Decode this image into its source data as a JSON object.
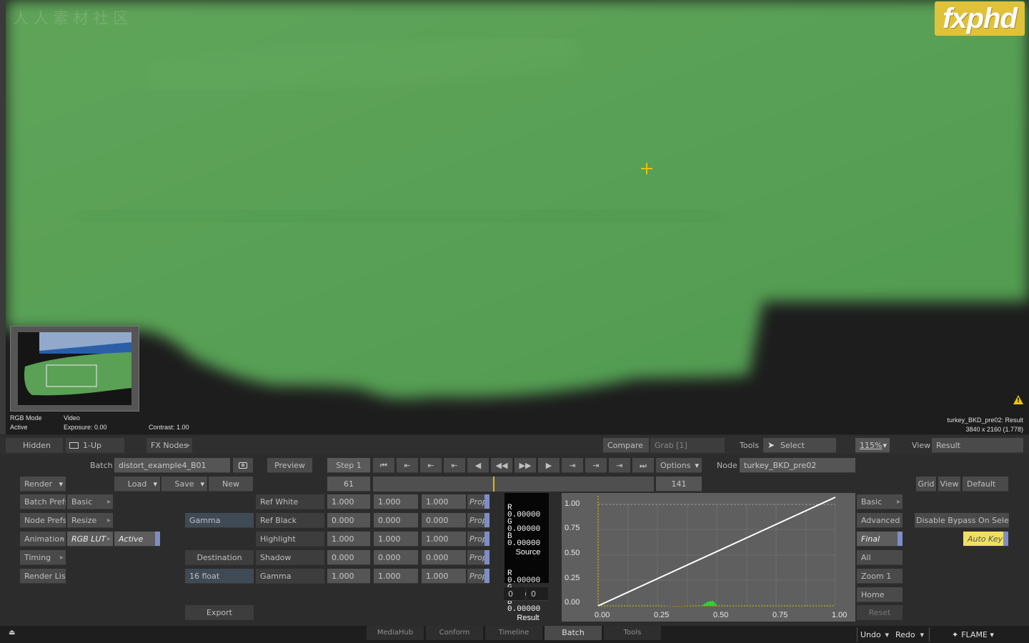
{
  "viewer": {
    "watermark": "人人素材社区",
    "brand_logo": "fxphd",
    "rgb_mode_label": "RGB Mode",
    "rgb_mode_value": "Active",
    "video_label": "Video",
    "exposure": "Exposure: 0.00",
    "contrast": "Contrast: 1.00",
    "clip_name": "turkey_BKD_pre02: Result",
    "resolution": "3840 x 2160 (1.778)",
    "warning_icon": "warning-icon",
    "crosshair_icon": "crosshair-icon"
  },
  "strip": {
    "hidden": "Hidden",
    "layout": "1-Up",
    "fx_nodes": "FX Nodes",
    "compare": "Compare",
    "grab": "Grab [1]",
    "tools_label": "Tools",
    "select": "Select",
    "zoom": "115%",
    "view_label": "View",
    "view_value": "Result"
  },
  "batch": {
    "label": "Batch",
    "name": "distort_example4_B01",
    "preview": "Preview",
    "step": "Step 1",
    "options": "Options",
    "node_label": "Node",
    "node_name": "turkey_BKD_pre02",
    "render": "Render",
    "load": "Load",
    "save": "Save",
    "new": "New",
    "frame_start": "61",
    "frame_end": "141",
    "grid": "Grid",
    "view": "View",
    "default": "Default"
  },
  "left_menu": {
    "batch_prefs": "Batch Prefs",
    "basic": "Basic",
    "node_prefs": "Node Prefs",
    "resize": "Resize",
    "animation": "Animation",
    "rgb_lut": "RGB LUT",
    "active": "Active",
    "timing": "Timing",
    "render_list": "Render List"
  },
  "lut": {
    "gamma_button": "Gamma",
    "destination": "Destination",
    "depth": "16 float",
    "export": "Export",
    "rows": [
      {
        "label": "Ref White",
        "r": "1.000",
        "g": "1.000",
        "b": "1.000",
        "prop": "Prop"
      },
      {
        "label": "Ref Black",
        "r": "0.000",
        "g": "0.000",
        "b": "0.000",
        "prop": "Prop"
      },
      {
        "label": "Highlight",
        "r": "1.000",
        "g": "1.000",
        "b": "1.000",
        "prop": "Prop"
      },
      {
        "label": "Shadow",
        "r": "0.000",
        "g": "0.000",
        "b": "0.000",
        "prop": "Prop"
      },
      {
        "label": "Gamma",
        "r": "1.000",
        "g": "1.000",
        "b": "1.000",
        "prop": "Prop"
      }
    ]
  },
  "color_display": {
    "source": {
      "r": "R  0.00000",
      "g": "G  0.00000",
      "b": "B  0.00000",
      "label": "Source"
    },
    "result": {
      "r": "R  0.00000",
      "g": "G  0.00000",
      "b": "B  0.00000",
      "label": "Result"
    },
    "field1": "0",
    "field2": "0"
  },
  "curve": {
    "y_ticks": [
      "1.00",
      "0.75",
      "0.50",
      "0.25",
      "0.00"
    ],
    "x_ticks": [
      "0.00",
      "0.25",
      "0.50",
      "0.75",
      "1.00"
    ]
  },
  "right_panel": {
    "basic": "Basic",
    "advanced": "Advanced",
    "final": "Final",
    "all": "All",
    "zoom": "Zoom 1",
    "home": "Home",
    "reset": "Reset",
    "disable_bypass": "Disable Bypass On Selection",
    "auto_key": "Auto Key"
  },
  "bottom": {
    "tabs": [
      "MediaHub",
      "Conform",
      "Timeline",
      "Batch",
      "Tools"
    ],
    "undo": "Undo",
    "redo": "Redo",
    "app": "FLAME"
  }
}
